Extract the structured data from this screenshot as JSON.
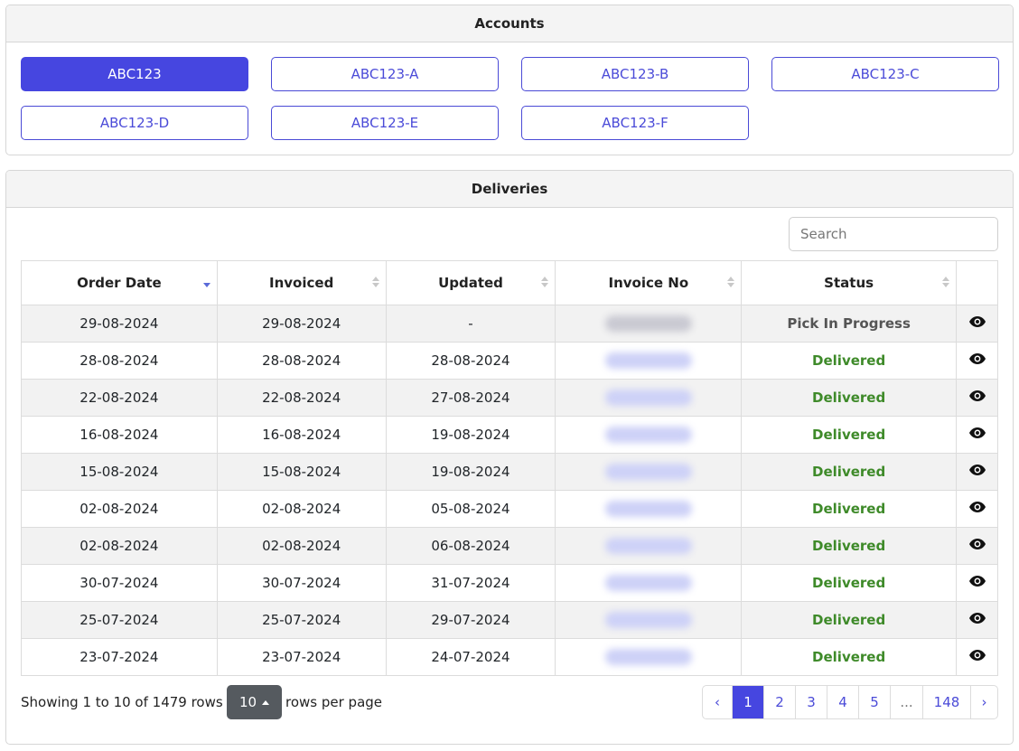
{
  "accounts": {
    "title": "Accounts",
    "items": [
      "ABC123",
      "ABC123-A",
      "ABC123-B",
      "ABC123-C",
      "ABC123-D",
      "ABC123-E",
      "ABC123-F"
    ],
    "active_index": 0
  },
  "deliveries": {
    "title": "Deliveries",
    "search_placeholder": "Search",
    "columns": [
      "Order Date",
      "Invoiced",
      "Updated",
      "Invoice No",
      "Status",
      ""
    ],
    "sorted_column": "Order Date",
    "sort_direction": "desc",
    "rows": [
      {
        "order_date": "29-08-2024",
        "invoiced": "29-08-2024",
        "updated": "-",
        "status": "Pick In Progress"
      },
      {
        "order_date": "28-08-2024",
        "invoiced": "28-08-2024",
        "updated": "28-08-2024",
        "status": "Delivered"
      },
      {
        "order_date": "22-08-2024",
        "invoiced": "22-08-2024",
        "updated": "27-08-2024",
        "status": "Delivered"
      },
      {
        "order_date": "16-08-2024",
        "invoiced": "16-08-2024",
        "updated": "19-08-2024",
        "status": "Delivered"
      },
      {
        "order_date": "15-08-2024",
        "invoiced": "15-08-2024",
        "updated": "19-08-2024",
        "status": "Delivered"
      },
      {
        "order_date": "02-08-2024",
        "invoiced": "02-08-2024",
        "updated": "05-08-2024",
        "status": "Delivered"
      },
      {
        "order_date": "02-08-2024",
        "invoiced": "02-08-2024",
        "updated": "06-08-2024",
        "status": "Delivered"
      },
      {
        "order_date": "30-07-2024",
        "invoiced": "30-07-2024",
        "updated": "31-07-2024",
        "status": "Delivered"
      },
      {
        "order_date": "25-07-2024",
        "invoiced": "25-07-2024",
        "updated": "29-07-2024",
        "status": "Delivered"
      },
      {
        "order_date": "23-07-2024",
        "invoiced": "23-07-2024",
        "updated": "24-07-2024",
        "status": "Delivered"
      }
    ],
    "row_action_icon": "eye-icon",
    "footer": {
      "showing_text": "Showing 1 to 10 of 1479 rows",
      "per_page_value": "10",
      "per_page_label": "rows per page"
    },
    "pagination": {
      "prev": "‹",
      "next": "›",
      "pages": [
        "1",
        "2",
        "3",
        "4",
        "5",
        "...",
        "148"
      ],
      "active_page": "1"
    }
  },
  "colors": {
    "primary": "#4646e0",
    "delivered": "#3e8a29",
    "header_bg": "#f4f4f4",
    "stripe": "#f2f2f2",
    "per_page_bg": "#555a5f"
  }
}
